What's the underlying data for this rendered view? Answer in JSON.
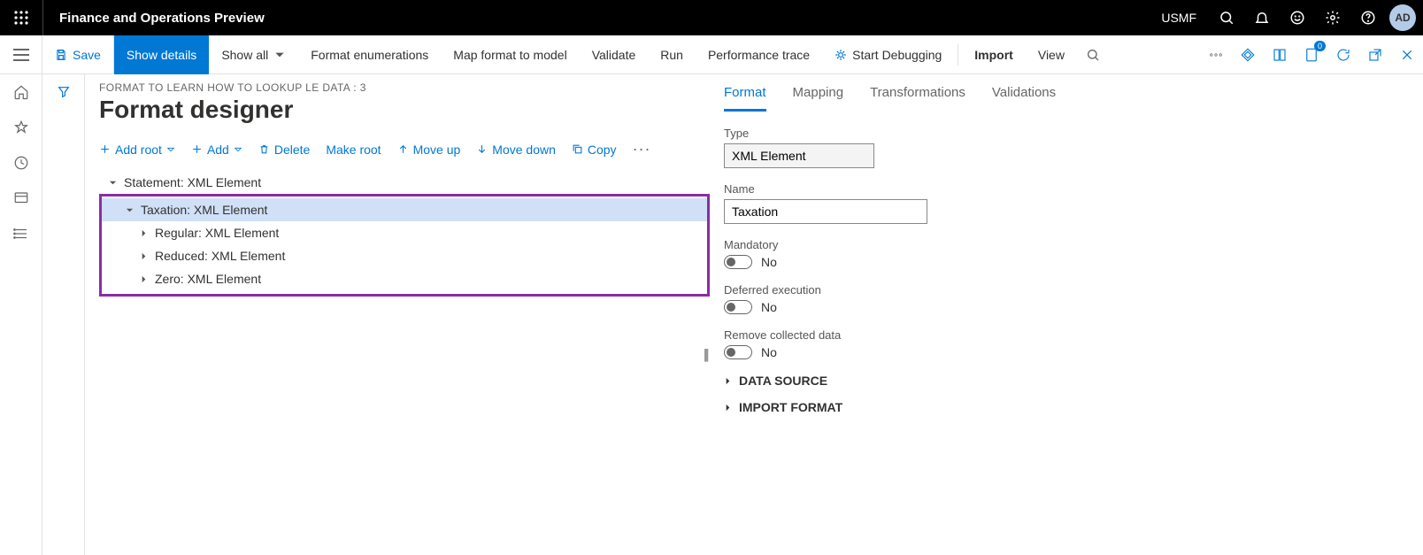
{
  "topbar": {
    "app_title": "Finance and Operations Preview",
    "company": "USMF",
    "avatar": "AD"
  },
  "actionbar": {
    "save": "Save",
    "show_details": "Show details",
    "show_all": "Show all",
    "format_enum": "Format enumerations",
    "map_format": "Map format to model",
    "validate": "Validate",
    "run": "Run",
    "perf_trace": "Performance trace",
    "start_debug": "Start Debugging",
    "import": "Import",
    "view": "View",
    "doc_badge": "0"
  },
  "page": {
    "breadcrumb": "FORMAT TO LEARN HOW TO LOOKUP LE DATA : 3",
    "title": "Format designer"
  },
  "toolbar2": {
    "add_root": "Add root",
    "add": "Add",
    "delete": "Delete",
    "make_root": "Make root",
    "move_up": "Move up",
    "move_down": "Move down",
    "copy": "Copy"
  },
  "tree": {
    "root": "Statement: XML Element",
    "selected": "Taxation: XML Element",
    "children": [
      "Regular: XML Element",
      "Reduced: XML Element",
      "Zero: XML Element"
    ]
  },
  "tabs": {
    "format": "Format",
    "mapping": "Mapping",
    "transformations": "Transformations",
    "validations": "Validations"
  },
  "form": {
    "type_label": "Type",
    "type_value": "XML Element",
    "name_label": "Name",
    "name_value": "Taxation",
    "mandatory_label": "Mandatory",
    "mandatory_value": "No",
    "deferred_label": "Deferred execution",
    "deferred_value": "No",
    "remove_label": "Remove collected data",
    "remove_value": "No",
    "data_source": "DATA SOURCE",
    "import_format": "IMPORT FORMAT"
  }
}
